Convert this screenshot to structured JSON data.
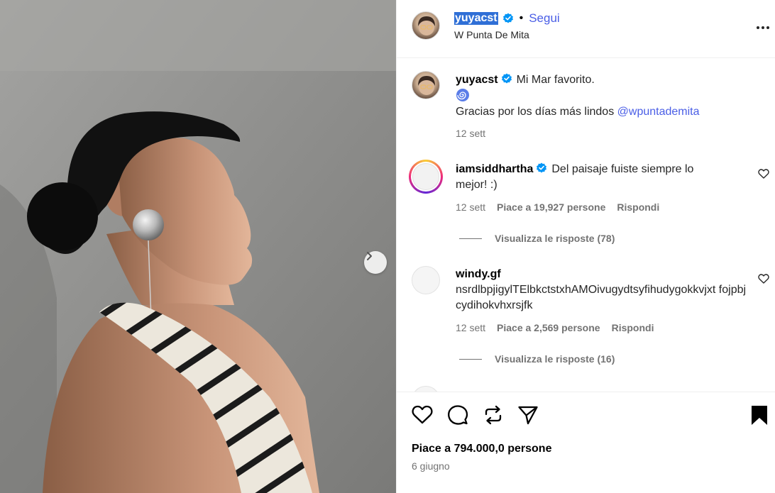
{
  "post": {
    "image_alt": "Woman in profile with black head wrap, silver sphere earring and striped top",
    "next_icon": "chevron-right-icon"
  },
  "header": {
    "username": "yuyacst",
    "separator": "•",
    "follow_label": "Segui",
    "location": "W Punta De Mita",
    "more_icon": "more-horizontal-icon"
  },
  "caption": {
    "username": "yuyacst",
    "line1": "Mi Mar favorito.",
    "emoji": "🌀",
    "line2_text": "Gracias por los días más lindos ",
    "mention": "@wpuntademita",
    "time": "12 sett"
  },
  "comments": [
    {
      "username": "iamsiddhartha",
      "verified": true,
      "text": "Del paisaje fuiste siempre lo mejor! :)",
      "time": "12 sett",
      "likes": "Piace a 19,927 persone",
      "reply": "Rispondi",
      "view_replies": "Visualizza le risposte (78)"
    },
    {
      "username": "windy.gf",
      "verified": false,
      "text": "nsrdlbpjigylTElbkctstxhAMOivugydtsyfihudygokkvjxt fojpbjcydihokvhxrsjfk",
      "time": "12 sett",
      "likes": "Piace a 2,569 persone",
      "reply": "Rispondi",
      "view_replies": "Visualizza le risposte (16)"
    }
  ],
  "actions": {
    "like_icon": "heart-icon",
    "comment_icon": "comment-icon",
    "share_icon": "repost-icon",
    "send_icon": "send-icon",
    "save_icon": "bookmark-filled-icon",
    "likes_text": "Piace a 794.000,0 persone",
    "date": "6 giugno"
  },
  "colors": {
    "link": "#4a5ee6",
    "muted": "#737373",
    "verified": "#0095f6",
    "selection": "#2f6fd6"
  }
}
